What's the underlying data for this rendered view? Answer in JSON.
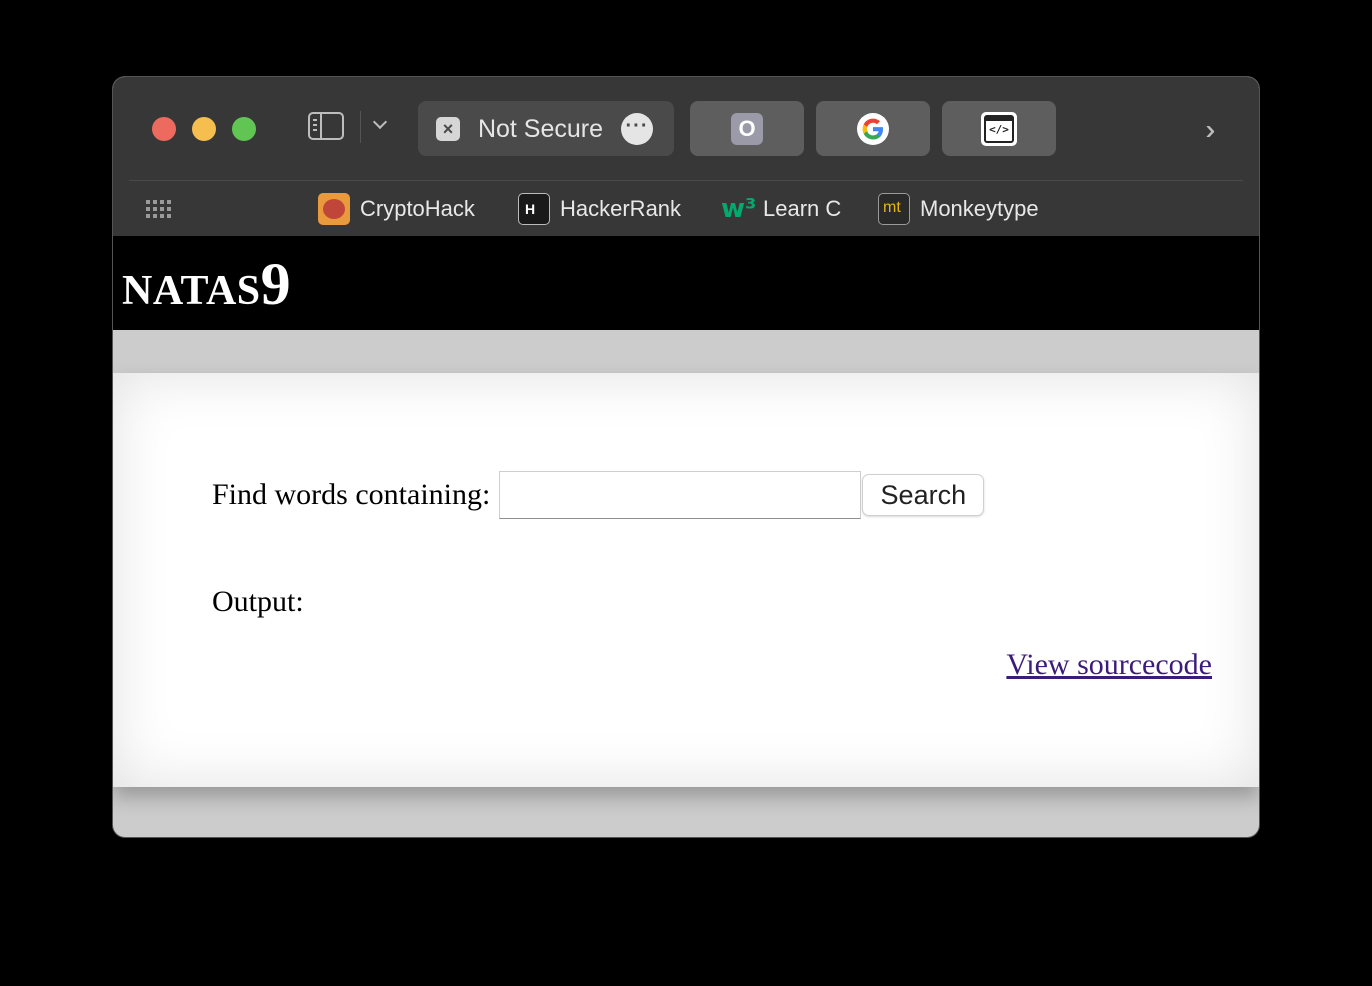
{
  "browser": {
    "active_tab": {
      "title": "Not Secure"
    },
    "pinned_tabs": [
      {
        "icon": "o-letter-icon",
        "letter": "O"
      },
      {
        "icon": "google-icon"
      },
      {
        "icon": "code-window-icon",
        "glyph": "</>"
      }
    ],
    "bookmarks": [
      {
        "label": "CryptoHack",
        "icon": "brain-icon"
      },
      {
        "label": "HackerRank",
        "icon": "hackerrank-icon",
        "icon_text": "H"
      },
      {
        "label": "Learn C",
        "icon": "w3schools-icon",
        "icon_text": "w³"
      },
      {
        "label": "Monkeytype",
        "icon": "monkeytype-icon",
        "icon_text": "mt"
      }
    ]
  },
  "page": {
    "header": {
      "title_text": "NATAS",
      "title_number": "9"
    },
    "form": {
      "label": "Find words containing:",
      "input_value": "",
      "button_label": "Search"
    },
    "output_label": "Output:",
    "view_source_link": "View sourcecode"
  },
  "colors": {
    "titlebar": "#373738",
    "page_header": "#000000",
    "page_background": "#cccccc",
    "content_background": "#ffffff",
    "link_visited": "#3b1c7a"
  }
}
